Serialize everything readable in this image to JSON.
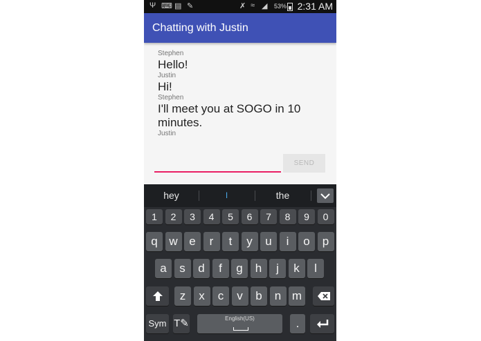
{
  "status_bar": {
    "battery": "53%",
    "time": "2:31 AM"
  },
  "app_bar": {
    "title": "Chatting with Justin"
  },
  "messages": [
    {
      "sender": "Stephen",
      "text": "Hello!"
    },
    {
      "sender": "Justin",
      "text": "Hi!"
    },
    {
      "sender": "Stephen",
      "text": "I'll meet you at SOGO in 10 minutes."
    },
    {
      "sender": "Justin",
      "text": ""
    }
  ],
  "composer": {
    "value": "",
    "send_label": "SEND"
  },
  "keyboard": {
    "suggestions": [
      "hey",
      "I",
      "the"
    ],
    "number_row": [
      "1",
      "2",
      "3",
      "4",
      "5",
      "6",
      "7",
      "8",
      "9",
      "0"
    ],
    "row1": [
      "q",
      "w",
      "e",
      "r",
      "t",
      "y",
      "u",
      "i",
      "o",
      "p"
    ],
    "row2": [
      "a",
      "s",
      "d",
      "f",
      "g",
      "h",
      "j",
      "k",
      "l"
    ],
    "row3": [
      "z",
      "x",
      "c",
      "v",
      "b",
      "n",
      "m"
    ],
    "sym_label": "Sym",
    "space_label": "English(US)",
    "period_label": "."
  },
  "colors": {
    "app_bar": "#3f51b5",
    "input_underline": "#e91e63",
    "keyboard_bg": "#2a2c30"
  }
}
